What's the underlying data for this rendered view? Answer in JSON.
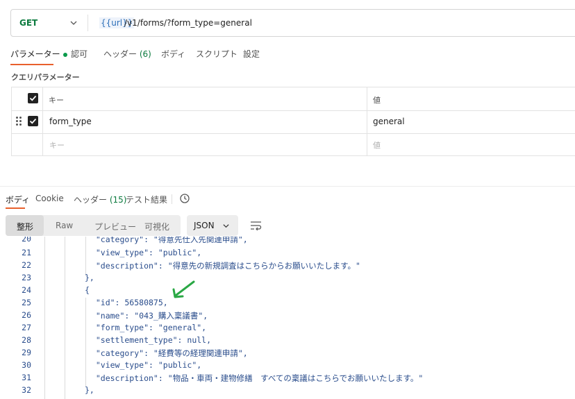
{
  "request": {
    "method": "GET",
    "url_variable": "{{url}}",
    "url_path": "/v1/forms/?form_type=general"
  },
  "request_tabs": [
    {
      "label": "パラメーター",
      "active": true
    },
    {
      "label": "認可"
    },
    {
      "label": "ヘッダー",
      "count": "(6)"
    },
    {
      "label": "ボディ"
    },
    {
      "label": "スクリプト"
    },
    {
      "label": "設定"
    }
  ],
  "query_section_title": "クエリパラメーター",
  "params_table": {
    "col_key": "キー",
    "col_value": "値",
    "rows": [
      {
        "key": "form_type",
        "value": "general"
      }
    ],
    "new_key_placeholder": "キー",
    "new_value_placeholder": "値"
  },
  "response_tabs": [
    {
      "label": "ボディ",
      "active": true
    },
    {
      "label": "Cookie"
    },
    {
      "label": "ヘッダー",
      "count": "(15)"
    },
    {
      "label": "テスト結果"
    }
  ],
  "view_modes": [
    "整形",
    "Raw",
    "プレビュー",
    "可視化"
  ],
  "format_select": "JSON",
  "code_lines": [
    {
      "n": "20",
      "t": "  \"category\": \"得意先仕入先関連申請\","
    },
    {
      "n": "21",
      "t": "  \"view_type\": \"public\","
    },
    {
      "n": "22",
      "t": "  \"description\": \"得意先の新規調査はこちらからお願いいたします。\""
    },
    {
      "n": "23",
      "t": "},"
    },
    {
      "n": "24",
      "t": "{"
    },
    {
      "n": "25",
      "t": "  \"id\": 56580875,"
    },
    {
      "n": "26",
      "t": "  \"name\": \"043_購入稟議書\","
    },
    {
      "n": "27",
      "t": "  \"form_type\": \"general\","
    },
    {
      "n": "28",
      "t": "  \"settlement_type\": null,"
    },
    {
      "n": "29",
      "t": "  \"category\": \"経費等の経理関連申請\","
    },
    {
      "n": "30",
      "t": "  \"view_type\": \"public\","
    },
    {
      "n": "31",
      "t": "  \"description\": \"物品・車両・建物修繕　すべての稟議はこちらでお願いいたします。\""
    },
    {
      "n": "32",
      "t": "},"
    }
  ],
  "colors": {
    "accent": "#e8602c",
    "method_green": "#0b7a3e",
    "json_text": "#2a4d8c",
    "annotation_arrow": "#2aa845"
  },
  "icons": [
    "chevron-down-icon",
    "drag-handle-icon",
    "checkbox-checked-icon",
    "history-icon",
    "wrap-lines-icon",
    "annotation-arrow-icon"
  ]
}
